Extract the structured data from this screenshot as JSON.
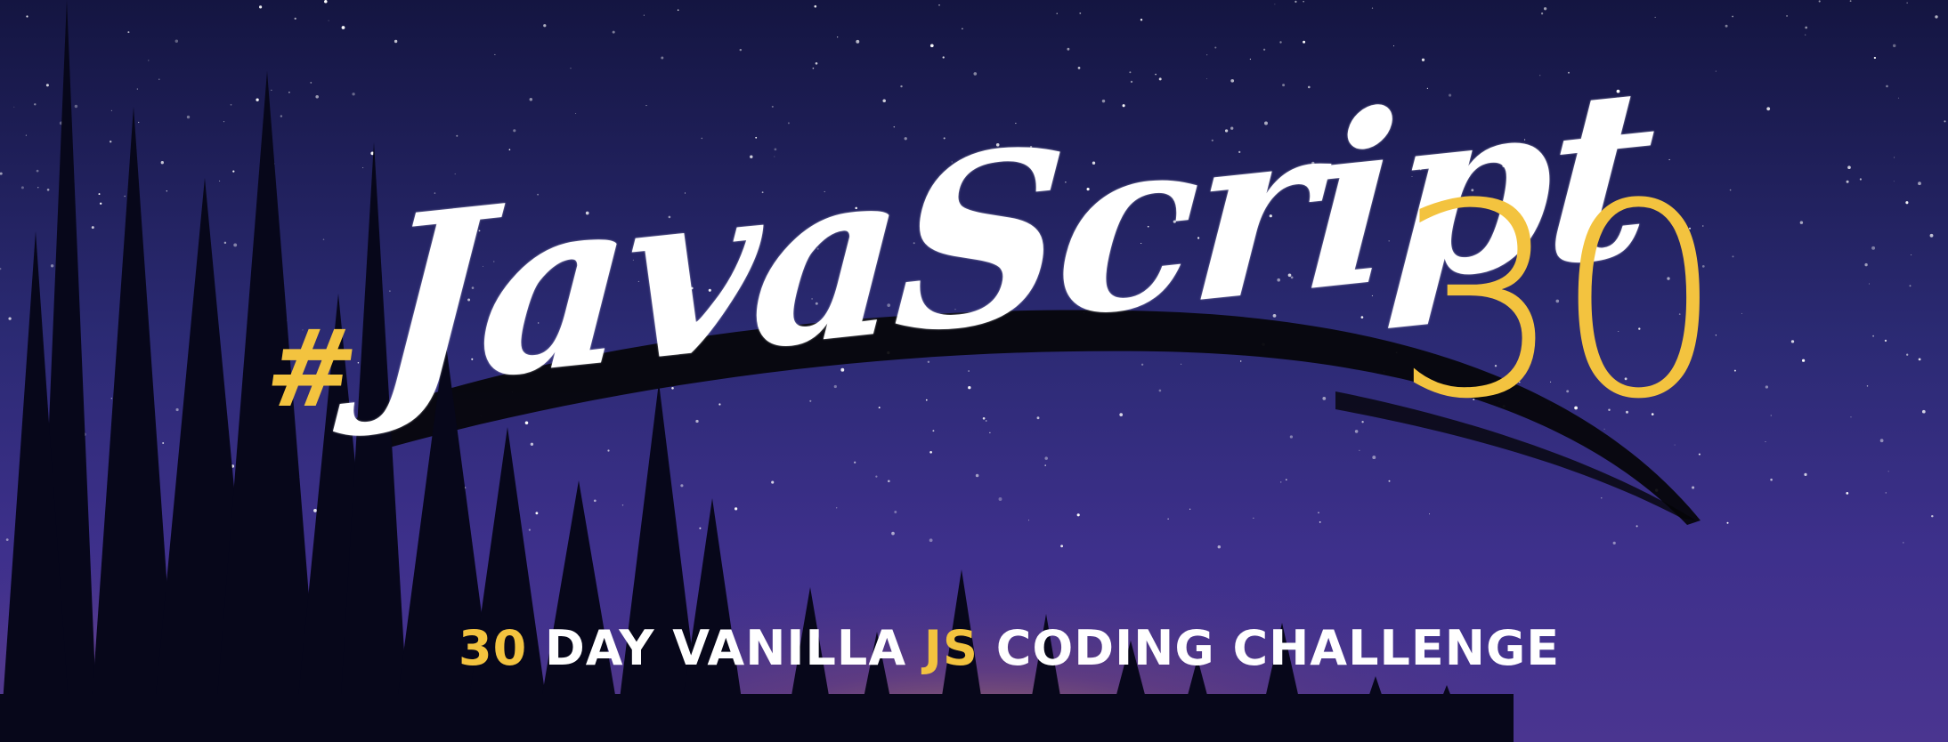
{
  "banner": {
    "hash": "#",
    "title_word": "JavaScript",
    "title_number": "30",
    "subtitle": {
      "part1": "30",
      "part2": " DAY VANILLA ",
      "part3": "JS",
      "part4": " CODING CHALLENGE"
    }
  },
  "colors": {
    "accent": "#f3c33f",
    "white": "#ffffff",
    "sky_top": "#15163c",
    "sky_mid": "#3a2f86",
    "brush": "#050508"
  }
}
